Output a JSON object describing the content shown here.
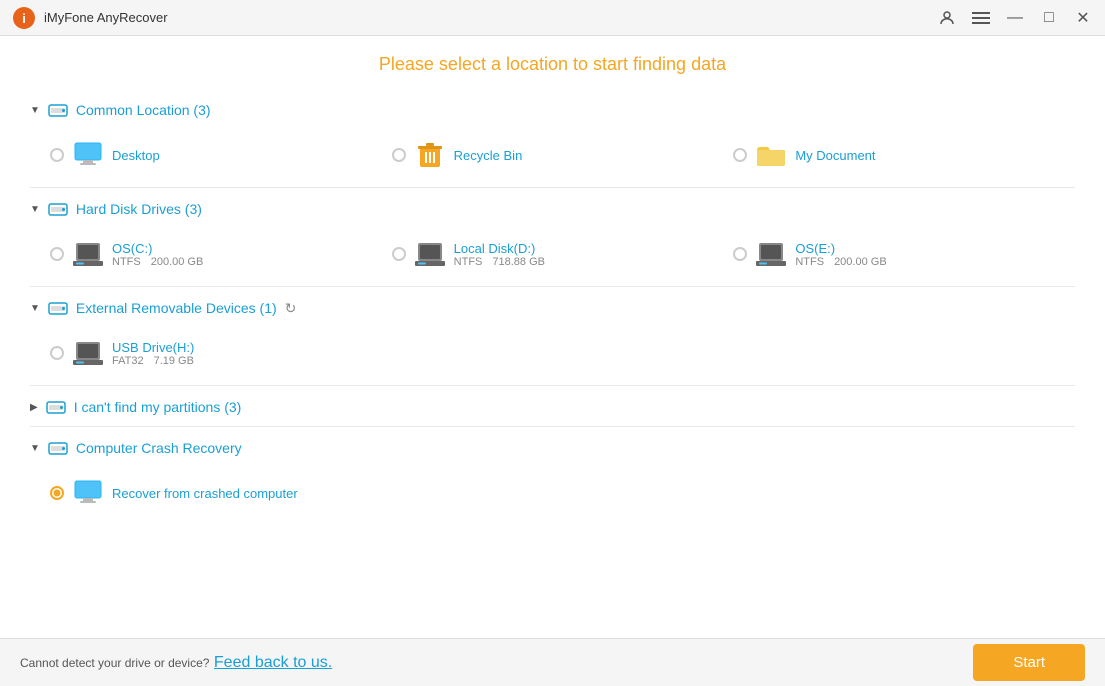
{
  "app": {
    "title": "iMyFone AnyRecover",
    "logo_color": "#e8631a"
  },
  "header": {
    "title": "Please select a location to start finding data"
  },
  "sections": [
    {
      "id": "common-location",
      "title": "Common Location (3)",
      "expanded": true,
      "items": [
        {
          "id": "desktop",
          "label": "Desktop",
          "type": "location",
          "icon": "desktop"
        },
        {
          "id": "recycle-bin",
          "label": "Recycle Bin",
          "type": "location",
          "icon": "recycle"
        },
        {
          "id": "my-document",
          "label": "My Document",
          "type": "location",
          "icon": "folder"
        }
      ]
    },
    {
      "id": "hard-disk-drives",
      "title": "Hard Disk Drives (3)",
      "expanded": true,
      "items": [
        {
          "id": "os-c",
          "label": "OS(C:)",
          "type": "disk",
          "fs": "NTFS",
          "size": "200.00 GB"
        },
        {
          "id": "local-d",
          "label": "Local Disk(D:)",
          "type": "disk",
          "fs": "NTFS",
          "size": "718.88 GB"
        },
        {
          "id": "os-e",
          "label": "OS(E:)",
          "type": "disk",
          "fs": "NTFS",
          "size": "200.00 GB"
        }
      ]
    },
    {
      "id": "external-removable",
      "title": "External Removable Devices (1)",
      "expanded": true,
      "has_refresh": true,
      "items": [
        {
          "id": "usb-h",
          "label": "USB Drive(H:)",
          "type": "disk",
          "fs": "FAT32",
          "size": "7.19 GB"
        }
      ]
    },
    {
      "id": "cant-find-partitions",
      "title": "I can't find my partitions (3)",
      "expanded": false,
      "items": []
    },
    {
      "id": "computer-crash",
      "title": "Computer Crash Recovery",
      "expanded": true,
      "items": [
        {
          "id": "recover-crashed",
          "label": "Recover from crashed computer",
          "type": "crash",
          "checked": true
        }
      ]
    }
  ],
  "bottom": {
    "text": "Cannot detect your drive or device?",
    "link_text": "Feed back to us.",
    "start_label": "Start"
  },
  "titlebar": {
    "buttons": {
      "minimize": "—",
      "maximize": "□",
      "close": "✕"
    }
  }
}
